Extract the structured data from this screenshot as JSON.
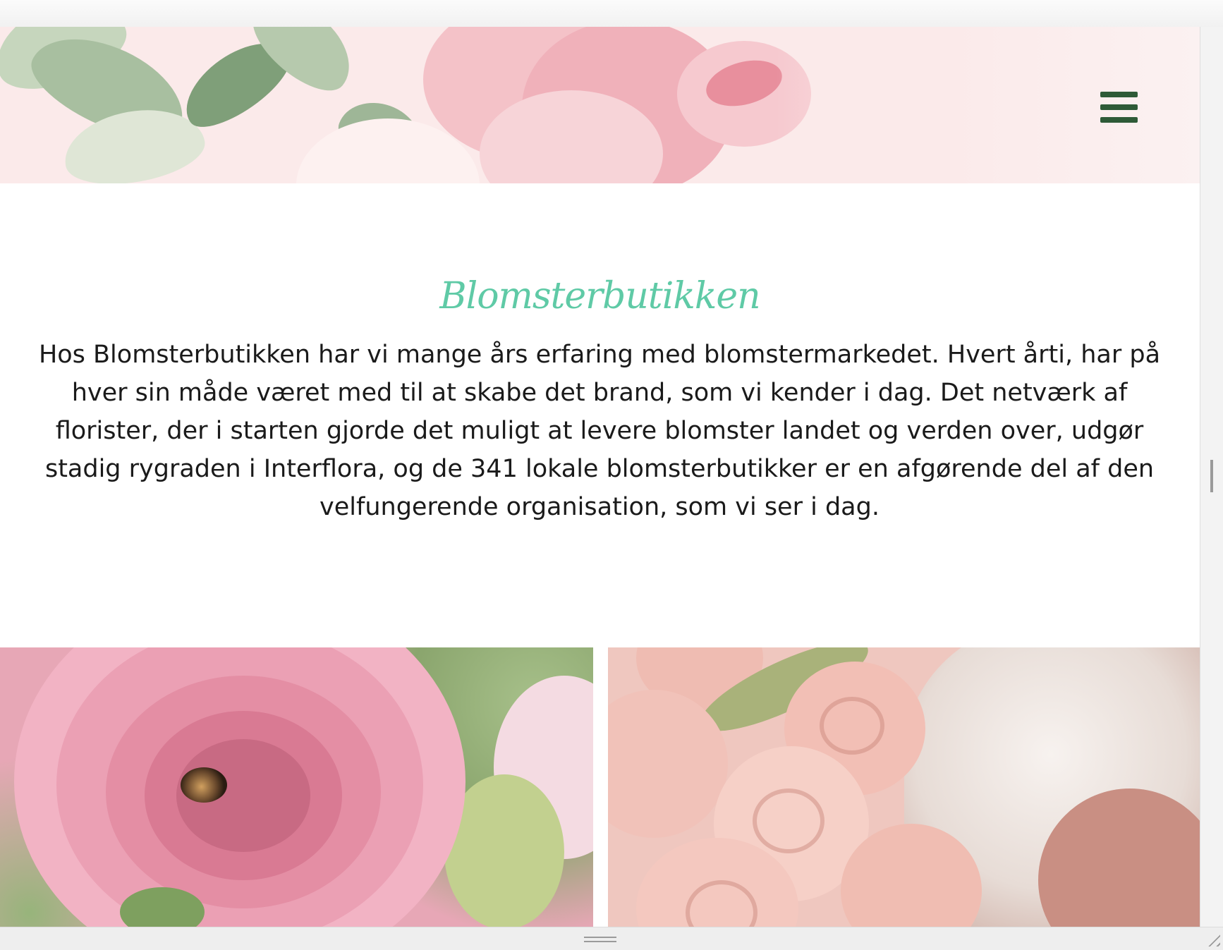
{
  "header": {
    "menu_icon": "hamburger-menu-icon",
    "menu_color": "#2e5a37",
    "banner_image": "pink-peony-and-green-leaves-banner"
  },
  "intro": {
    "title": "Blomsterbutikken",
    "title_color": "#5fcaa6",
    "text": "Hos Blomsterbutikken har vi mange års erfaring med blomstermarkedet. Hvert årti, har på hver sin måde været med til at skabe det brand, som vi kender i dag. Det netværk af florister, der i starten gjorde det muligt at levere blomster landet og verden over, udgør stadig rygraden i Interflora, og de 341 lokale blomsterbutikker er en afgørende del af den velfungerende organisation, som vi ser i dag."
  },
  "gallery": [
    {
      "image": "pink-ranunculus-closeup"
    },
    {
      "image": "pink-rose-bridal-bouquet"
    }
  ]
}
